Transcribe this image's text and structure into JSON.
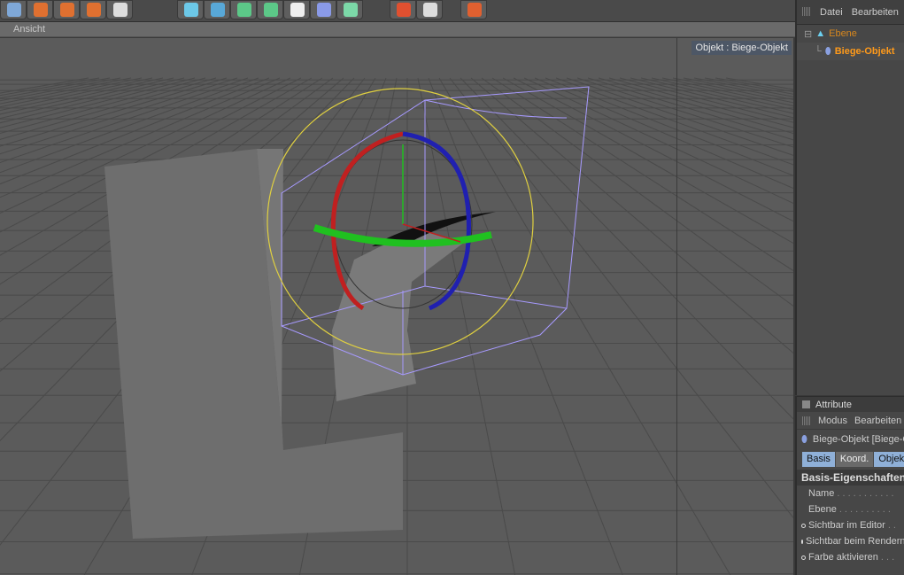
{
  "toolbar": {
    "tools": [
      "undo-icon",
      "redo-icon",
      "render-view-icon",
      "render-picture-icon",
      "render-settings-icon",
      "cube-icon",
      "spline-pen-icon",
      "nurbs-icon",
      "array-icon",
      "light-icon",
      "deformer-bend-icon",
      "particle-icon",
      "select-icon",
      "help-icon",
      "web-icon"
    ]
  },
  "viewport": {
    "menu": "Ansicht",
    "object_label": "Objekt : Biege-Objekt",
    "nav_icons": [
      "move-icon",
      "zoom-icon",
      "rotate-icon",
      "maximize-icon"
    ],
    "colors": {
      "background": "#5b5b5b",
      "gizmo_x": "#c02020",
      "gizmo_y": "#20c020",
      "gizmo_z": "#2020b0",
      "bbox": "#a79aff",
      "sphere": "#e0d040"
    }
  },
  "objects": {
    "menu": [
      "Datei",
      "Bearbeiten"
    ],
    "items": [
      {
        "name": "Ebene",
        "color": "#d7871e"
      },
      {
        "name": "Biege-Objekt",
        "color": "#ff9a1a"
      }
    ]
  },
  "attributes": {
    "title": "Attribute",
    "menu": [
      "Modus",
      "Bearbeiten"
    ],
    "object": "Biege-Objekt [Biege-Objekt]",
    "tabs": [
      "Basis",
      "Koord.",
      "Objekt"
    ],
    "section": "Basis-Eigenschaften",
    "props": [
      "Name",
      "Ebene",
      "Sichtbar im Editor",
      "Sichtbar beim Rendern",
      "Farbe aktivieren"
    ]
  }
}
